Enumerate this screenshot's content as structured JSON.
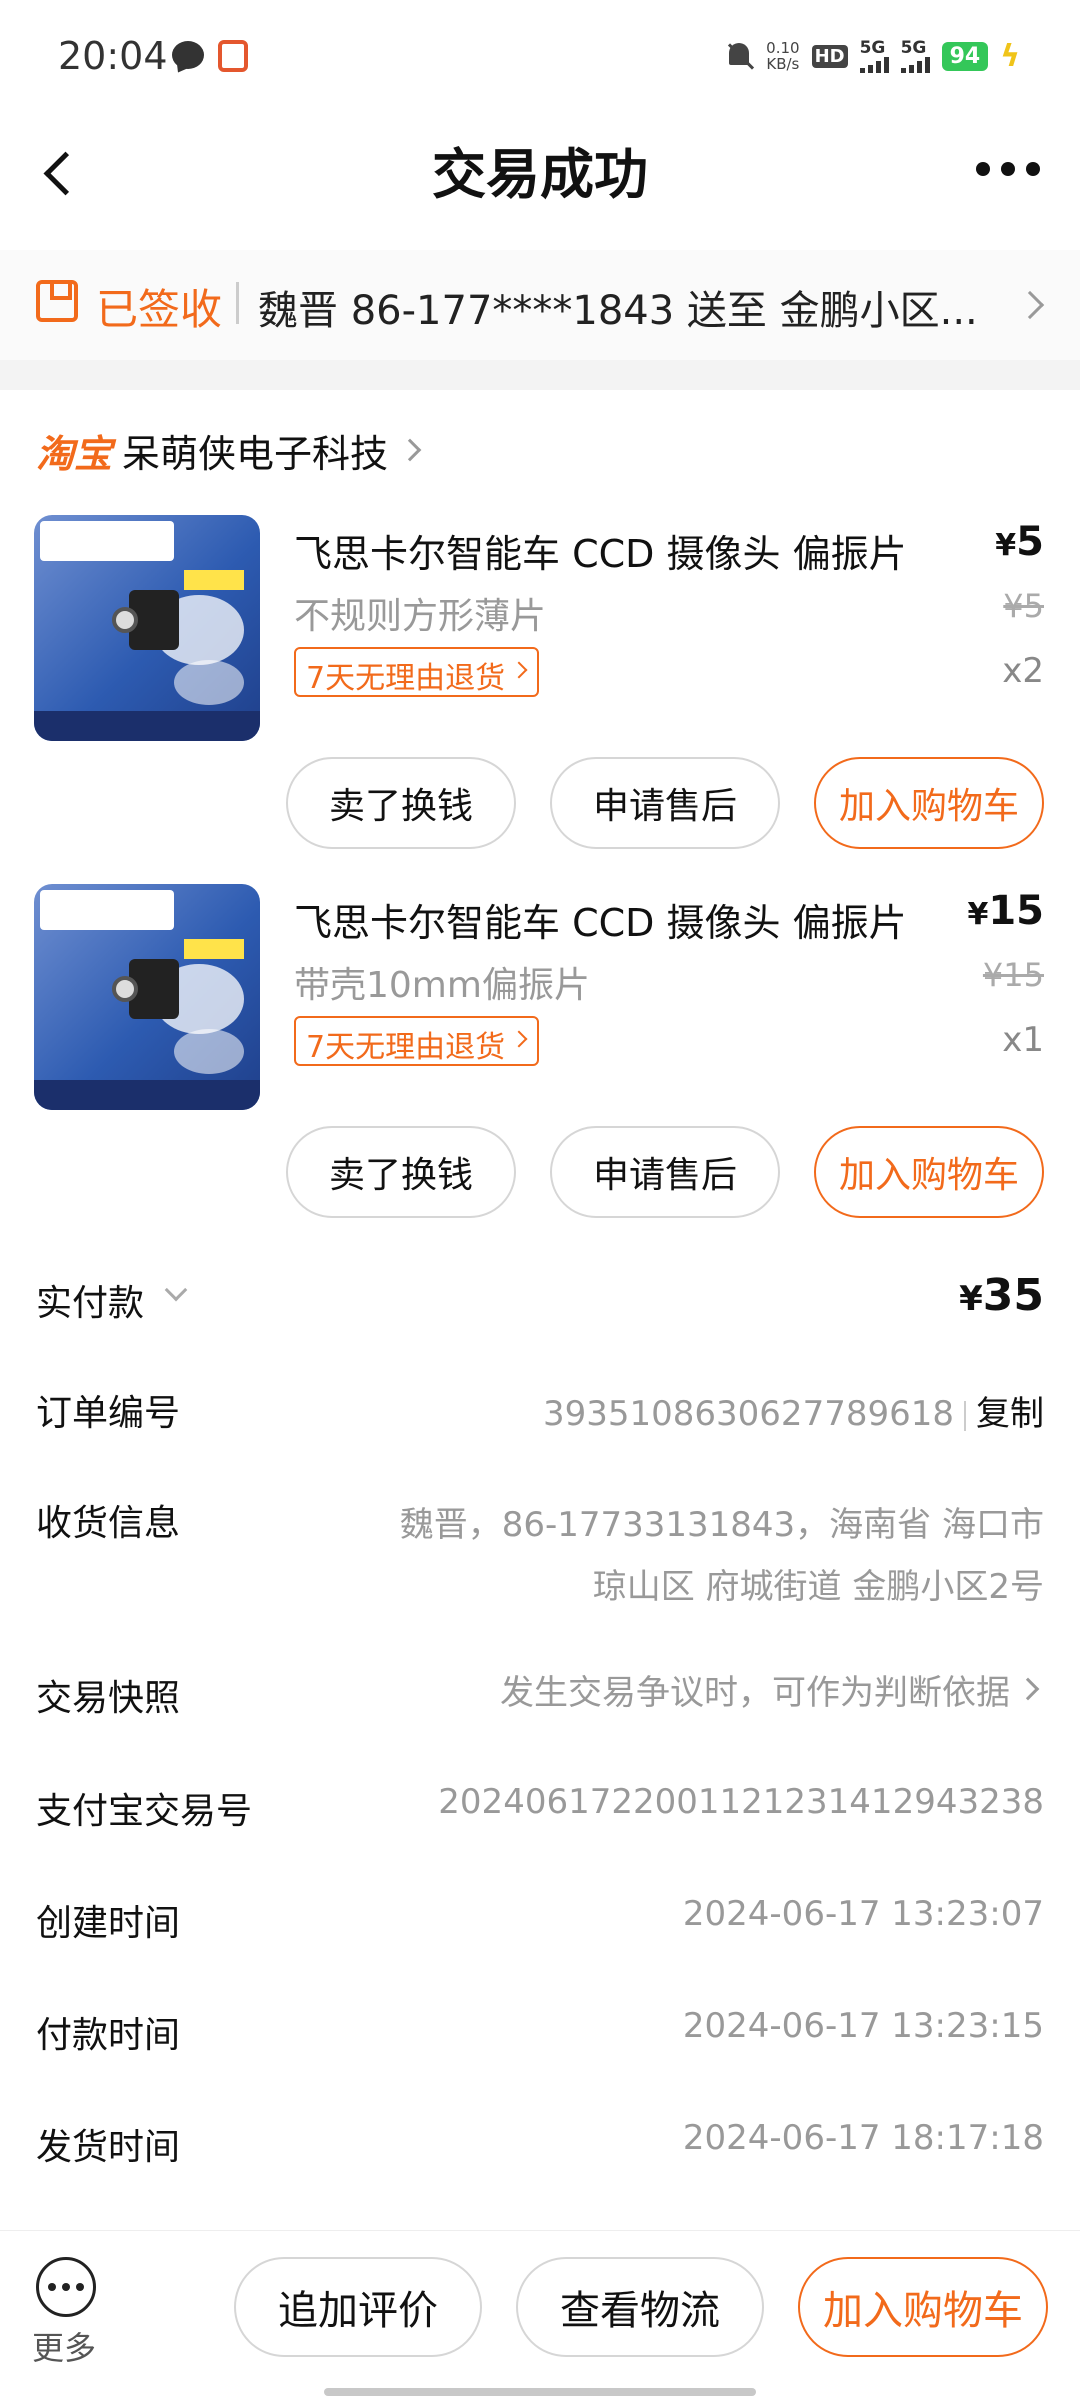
{
  "status_bar": {
    "time": "20:04",
    "net_speed_value": "0.10",
    "net_speed_unit": "KB/s",
    "hd_label": "HD",
    "sim1_label": "5G",
    "sim2_label": "5G",
    "battery": "94"
  },
  "header": {
    "title": "交易成功"
  },
  "delivery": {
    "status": "已签收",
    "summary": "魏晋 86-177****1843 送至 金鹏小区..."
  },
  "shop": {
    "platform": "淘宝",
    "name": "呆萌侠电子科技"
  },
  "products": [
    {
      "title": "飞思卡尔智能车 CCD 摄像头 偏振片",
      "spec": "不规则方形薄片",
      "return_policy": "7天无理由退货",
      "currency": "¥",
      "price": "5",
      "original_price": "¥5",
      "quantity": "x2",
      "actions": [
        "卖了换钱",
        "申请售后",
        "加入购物车"
      ]
    },
    {
      "title": "飞思卡尔智能车 CCD 摄像头 偏振片",
      "spec": "带壳10mm偏振片",
      "return_policy": "7天无理由退货",
      "currency": "¥",
      "price": "15",
      "original_price": "¥15",
      "quantity": "x1",
      "actions": [
        "卖了换钱",
        "申请售后",
        "加入购物车"
      ]
    }
  ],
  "details": {
    "paid_label": "实付款",
    "paid_currency": "¥",
    "paid_amount": "35",
    "order_no_label": "订单编号",
    "order_no": "3935108630627789618",
    "copy_label": "复制",
    "shipping_label": "收货信息",
    "shipping_line1": "魏晋，86-17733131843，海南省 海口市",
    "shipping_line2": "琼山区 府城街道 金鹏小区2号",
    "snapshot_label": "交易快照",
    "snapshot_value": "发生交易争议时，可作为判断依据",
    "alipay_label": "支付宝交易号",
    "alipay_no": "2024061722001121231412943238",
    "created_label": "创建时间",
    "created_time": "2024-06-17 13:23:07",
    "paid_time_label": "付款时间",
    "paid_time": "2024-06-17 13:23:15",
    "shipped_label": "发货时间",
    "shipped_time": "2024-06-17 18:17:18"
  },
  "bottom_bar": {
    "more_label": "更多",
    "review_label": "追加评价",
    "logistics_label": "查看物流",
    "add_cart_label": "加入购物车"
  },
  "colors": {
    "accent": "#f26a1b",
    "battery": "#34c759"
  }
}
